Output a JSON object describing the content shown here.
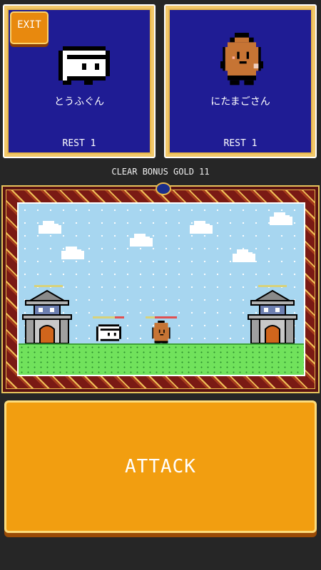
{
  "exit_label": "EXIT",
  "players": [
    {
      "name": "とうふぐん",
      "rest": "REST 1",
      "sprite": "tofu-icon"
    },
    {
      "name": "にたまごさん",
      "rest": "REST 1",
      "sprite": "egg-icon"
    }
  ],
  "bonus_text": "CLEAR BONUS GOLD 11",
  "attack_label": "ATTACK",
  "colors": {
    "card_bg": "#1f1c94",
    "card_frame": "#f2c86a",
    "button": "#f29e10",
    "sky": "#a7d6f0",
    "grass": "#71e25c"
  }
}
